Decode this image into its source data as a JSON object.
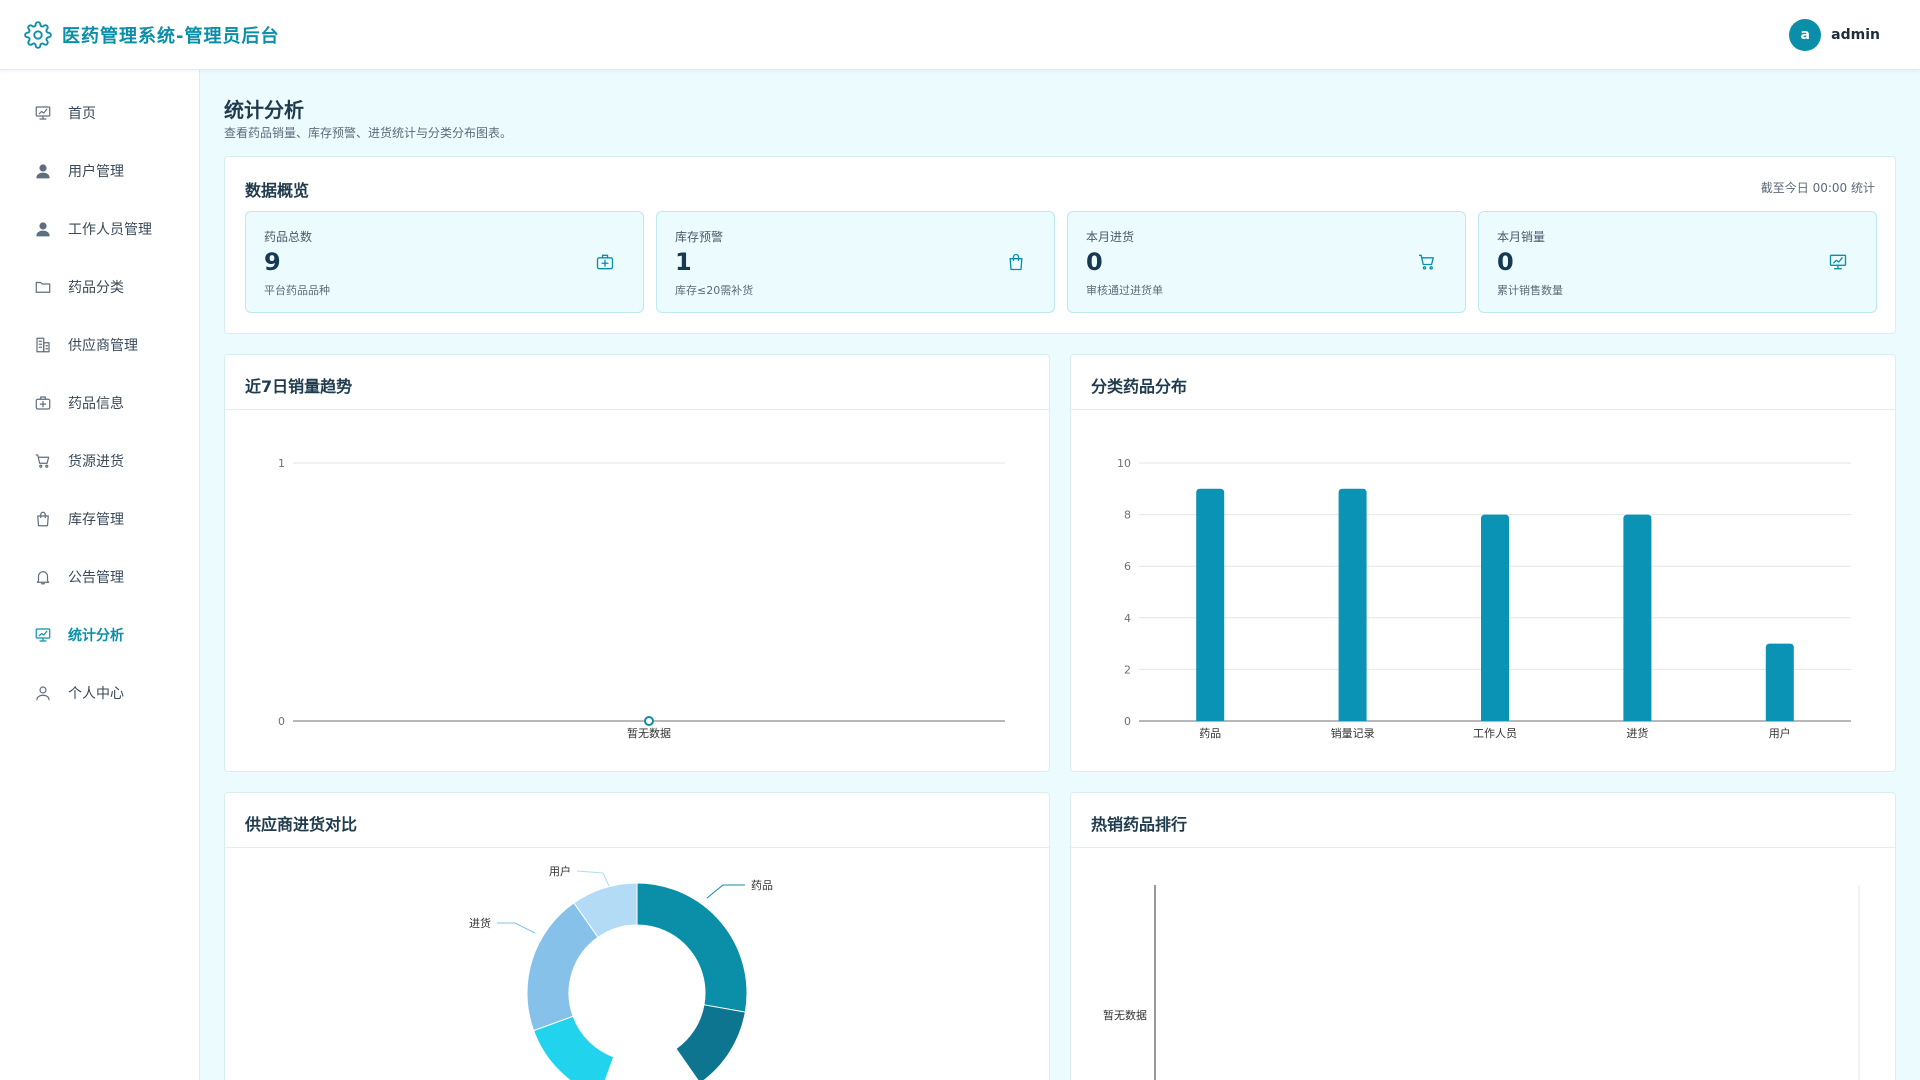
{
  "header": {
    "title": "医药管理系统-管理员后台",
    "avatar_letter": "a",
    "username": "admin"
  },
  "sidebar": {
    "items": [
      {
        "label": "首页",
        "icon": "chart-board-icon",
        "active": false
      },
      {
        "label": "用户管理",
        "icon": "user-icon",
        "active": false
      },
      {
        "label": "工作人员管理",
        "icon": "staff-icon",
        "active": false
      },
      {
        "label": "药品分类",
        "icon": "folder-icon",
        "active": false
      },
      {
        "label": "供应商管理",
        "icon": "building-icon",
        "active": false
      },
      {
        "label": "药品信息",
        "icon": "medical-box-icon",
        "active": false
      },
      {
        "label": "货源进货",
        "icon": "cart-icon",
        "active": false
      },
      {
        "label": "库存管理",
        "icon": "bag-icon",
        "active": false
      },
      {
        "label": "公告管理",
        "icon": "bell-icon",
        "active": false
      },
      {
        "label": "统计分析",
        "icon": "chart-board-icon",
        "active": true
      },
      {
        "label": "个人中心",
        "icon": "person-outline-icon",
        "active": false
      }
    ]
  },
  "page": {
    "title": "统计分析",
    "subtitle": "查看药品销量、库存预警、进货统计与分类分布图表。"
  },
  "overview": {
    "title": "数据概览",
    "note": "截至今日 00:00 统计",
    "cards": [
      {
        "label": "药品总数",
        "value": "9",
        "desc": "平台药品品种",
        "icon": "medical-box-icon"
      },
      {
        "label": "库存预警",
        "value": "1",
        "desc": "库存≤20需补货",
        "icon": "bag-icon"
      },
      {
        "label": "本月进货",
        "value": "0",
        "desc": "审核通过进货单",
        "icon": "cart-icon"
      },
      {
        "label": "本月销量",
        "value": "0",
        "desc": "累计销售数量",
        "icon": "chart-board-icon"
      }
    ]
  },
  "charts": {
    "trend_title": "近7日销量趋势",
    "category_title": "分类药品分布",
    "supplier_title": "供应商进货对比",
    "hot_title": "热销药品排行"
  },
  "colors": {
    "accent": "#0b8fa8",
    "bar": "#0b93b5",
    "pie": [
      "#0b8fa8",
      "#0e7590",
      "#22d3ee",
      "#86c1ea",
      "#b3dbf5"
    ]
  },
  "chart_data": [
    {
      "type": "line",
      "title": "近7日销量趋势",
      "categories": [
        "暂无数据"
      ],
      "series": [
        {
          "values": [
            0
          ]
        }
      ],
      "ylim": [
        0,
        1
      ],
      "yticks": [
        0,
        1
      ]
    },
    {
      "type": "bar",
      "title": "分类药品分布",
      "categories": [
        "药品",
        "销量记录",
        "工作人员",
        "进货",
        "用户"
      ],
      "values": [
        9,
        9,
        8,
        8,
        3
      ],
      "ylim": [
        0,
        10
      ],
      "yticks": [
        0,
        2,
        4,
        6,
        8,
        10
      ],
      "grid": true
    },
    {
      "type": "pie",
      "title": "供应商进货对比",
      "categories": [
        "药品",
        "进货",
        "用户"
      ],
      "note": "donut chart, partially visible; additional slices below the visible area are unlabeled"
    },
    {
      "type": "bar",
      "title": "热销药品排行",
      "categories": [
        "暂无数据"
      ],
      "values": []
    }
  ]
}
